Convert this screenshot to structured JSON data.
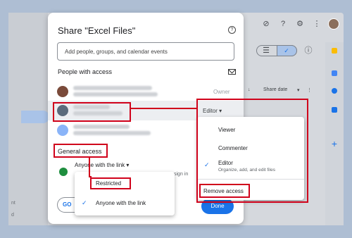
{
  "dialog": {
    "title": "Share \"Excel Files\"",
    "help_icon": "help-icon",
    "add_placeholder": "Add people, groups, and calendar events",
    "people_heading": "People with access",
    "owner_label": "Owner",
    "editor_role": "Editor",
    "general_access_heading": "General access",
    "general_access_value": "Anyone with the link",
    "sign_in_fragment": "sign in",
    "copy_label": "GO",
    "done_label": "Done"
  },
  "list_header": {
    "sort_label": "Share date",
    "more": "⋮",
    "arrow": "↓"
  },
  "role_menu": {
    "items": [
      {
        "label": "Viewer"
      },
      {
        "label": "Commenter"
      },
      {
        "label": "Editor",
        "sub": "Organize, add, and edit files",
        "checked": true
      }
    ],
    "remove_label": "Remove access"
  },
  "access_menu": {
    "items": [
      {
        "label": "Restricted",
        "checked": false
      },
      {
        "label": "Anyone with the link",
        "checked": true
      }
    ]
  },
  "background": {
    "left_text_1": "nt",
    "left_text_2": "d"
  },
  "colors": {
    "accent": "#1a73e8",
    "annotation": "#d0021b"
  }
}
